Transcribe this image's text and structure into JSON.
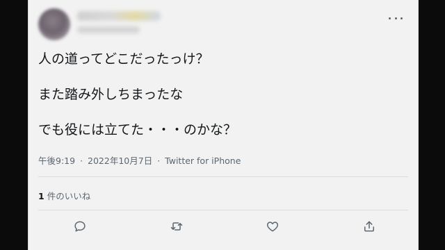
{
  "tweet": {
    "lines": [
      "人の道ってどこだったっけ？",
      "また踏み外しちまったな",
      "でも役には立てた・・・のかな？"
    ],
    "time": "午後9:19",
    "separator": "·",
    "date": "2022年10月7日",
    "source": "Twitter for iPhone"
  },
  "stats": {
    "likes_count": "1",
    "likes_label": "件のいいね"
  },
  "icons": {
    "more": "more-horizontal-icon",
    "reply": "reply-icon",
    "retweet": "retweet-icon",
    "like": "heart-icon",
    "share": "share-icon"
  },
  "colors": {
    "background": "#0b0b0b",
    "card": "#f2f2f2",
    "text": "#14171a",
    "secondary": "#5b6670"
  }
}
